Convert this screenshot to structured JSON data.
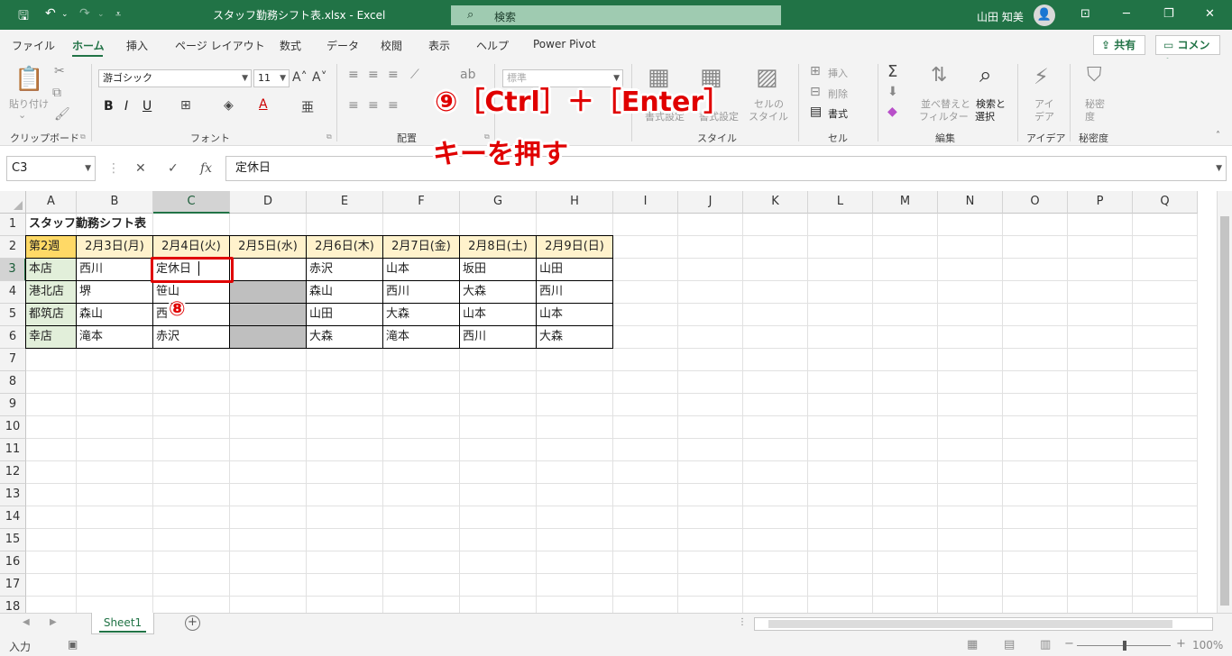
{
  "window": {
    "title": "スタッフ勤務シフト表.xlsx  -  Excel",
    "search_placeholder": "検索",
    "user_name": "山田 知美"
  },
  "tabs": [
    "ファイル",
    "ホーム",
    "挿入",
    "ページ レイアウト",
    "数式",
    "データ",
    "校閲",
    "表示",
    "ヘルプ",
    "Power Pivot"
  ],
  "header_buttons": {
    "share": "共有",
    "comment": "コメント"
  },
  "ribbon": {
    "groups": [
      "クリップボード",
      "フォント",
      "配置",
      "スタイル",
      "セル",
      "編集",
      "アイデア",
      "秘密度"
    ],
    "paste_label": "貼り付け",
    "font_name": "游ゴシック",
    "font_size": "11",
    "number_format": "標準",
    "cells_buttons": {
      "insert": "挿入",
      "delete": "削除",
      "format": "書式"
    },
    "style_buttons": {
      "conditional": "書式設定",
      "cell_style_1": "セルの",
      "cell_style_2": "スタイル"
    },
    "edit_buttons": {
      "sort_1": "並べ替えと",
      "sort_2": "フィルター",
      "find_1": "検索と",
      "find_2": "選択"
    },
    "ideas_1": "アイ",
    "ideas_2": "デア",
    "sensitivity_1": "秘密",
    "sensitivity_2": "度"
  },
  "annotations": {
    "step9_line1": "⑨［Ctrl］＋［Enter］",
    "step9_line2": "キーを押す",
    "step8": "⑧"
  },
  "formula_bar": {
    "name_box": "C3",
    "value": "定休日"
  },
  "columns": [
    "A",
    "B",
    "C",
    "D",
    "E",
    "F",
    "G",
    "H",
    "I",
    "J",
    "K",
    "L",
    "M",
    "N",
    "O",
    "P",
    "Q"
  ],
  "rows": [
    "1",
    "2",
    "3",
    "4",
    "5",
    "6",
    "7",
    "8",
    "9",
    "10",
    "11",
    "12",
    "13",
    "14",
    "15",
    "16",
    "17",
    "18"
  ],
  "sheet": {
    "title": "スタッフ勤務シフト表",
    "header_row": [
      "第2週",
      "2月3日(月)",
      "2月4日(火)",
      "2月5日(水)",
      "2月6日(木)",
      "2月7日(金)",
      "2月8日(土)",
      "2月9日(日)"
    ],
    "data_rows": [
      [
        "本店",
        "西川",
        "定休日",
        "",
        "赤沢",
        "山本",
        "坂田",
        "山田"
      ],
      [
        "港北店",
        "堺",
        "笹山",
        "",
        "森山",
        "西川",
        "大森",
        "西川"
      ],
      [
        "都筑店",
        "森山",
        "西",
        "",
        "山田",
        "大森",
        "山本",
        "山本"
      ],
      [
        "幸店",
        "滝本",
        "赤沢",
        "",
        "大森",
        "滝本",
        "西川",
        "大森"
      ]
    ]
  },
  "colors": {
    "excel_green": "#217346",
    "header_fill": "#fff2cc",
    "week_fill": "#ffd966",
    "store_fill": "#e2efda",
    "selected_gray": "#bfbfbf",
    "annotation_red": "#e00000"
  },
  "sheet_tab": "Sheet1",
  "status": {
    "mode": "入力",
    "zoom": "100%"
  }
}
